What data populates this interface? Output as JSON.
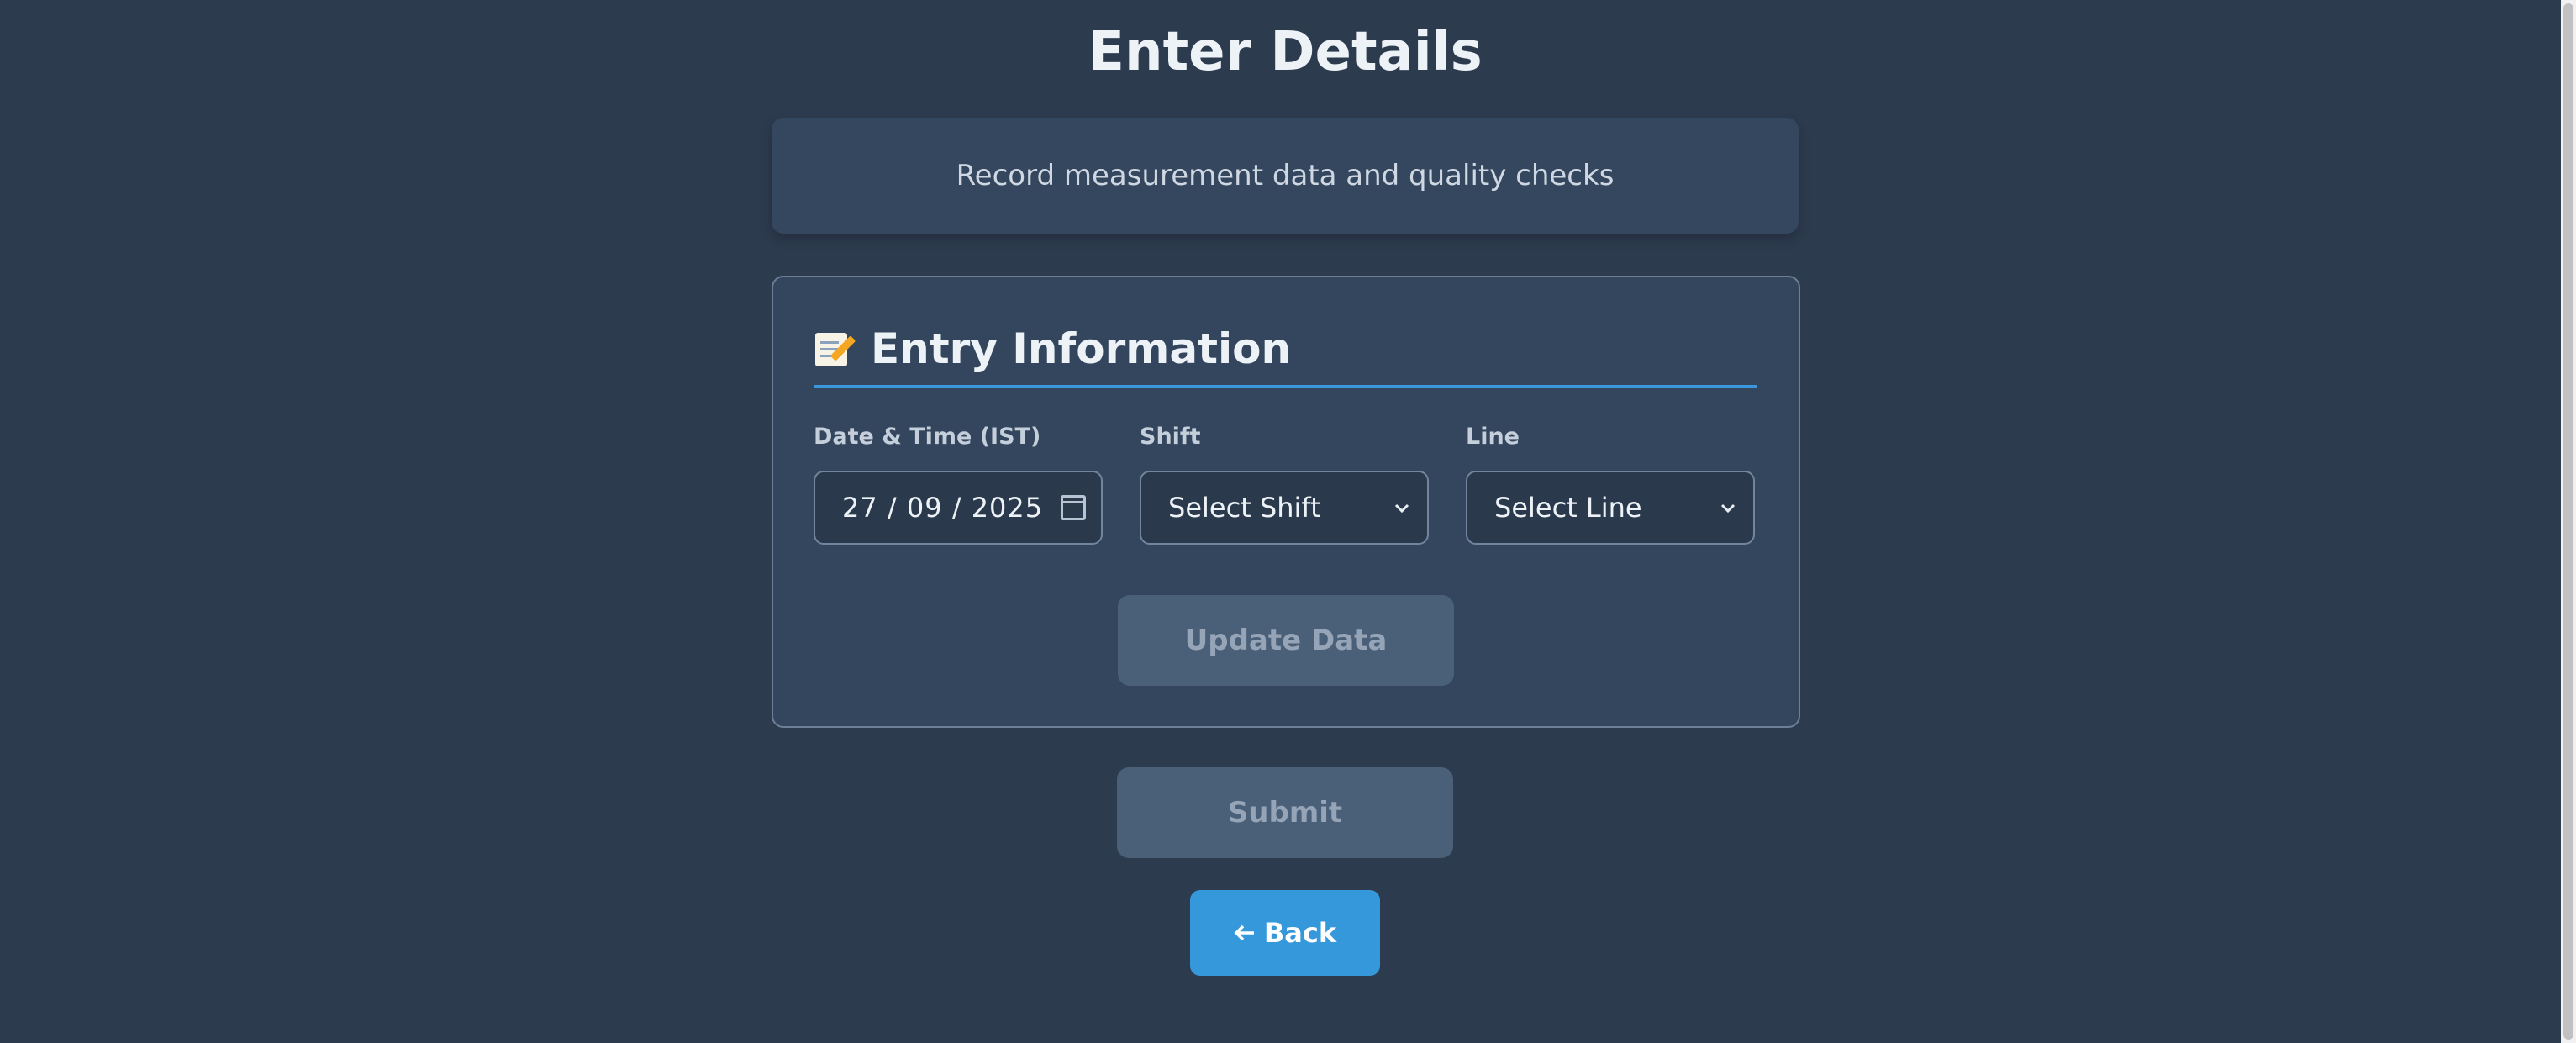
{
  "page": {
    "title": "Enter Details",
    "subtitle": "Record measurement data and quality checks"
  },
  "form": {
    "section_title": "Entry Information",
    "section_icon": "memo-icon",
    "fields": {
      "date": {
        "label": "Date & Time (IST)",
        "value": "27 / 09 / 2025",
        "icon": "calendar-icon"
      },
      "shift": {
        "label": "Shift",
        "selected": "Select Shift",
        "icon": "chevron-down-icon"
      },
      "line": {
        "label": "Line",
        "selected": "Select Line",
        "icon": "chevron-down-icon"
      }
    },
    "update_button": "Update Data"
  },
  "actions": {
    "submit_label": "Submit",
    "back_label": "Back",
    "back_icon": "left-arrow-icon"
  },
  "colors": {
    "background": "#2d3b4f",
    "card": "#33465d",
    "accent": "#3498db",
    "disabled_button": "#4a5f78"
  }
}
